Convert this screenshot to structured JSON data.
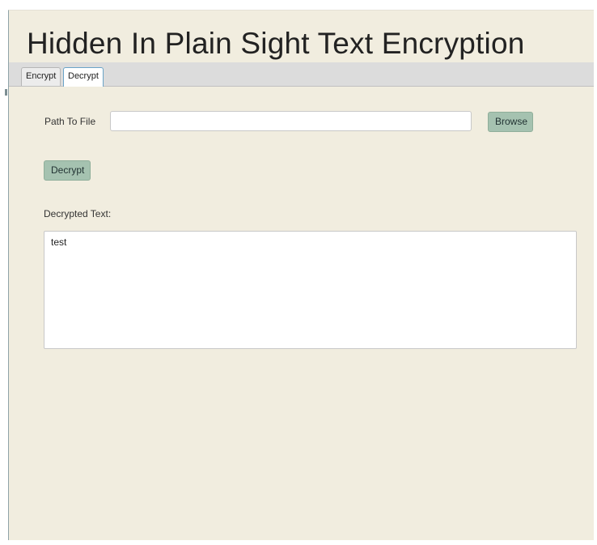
{
  "app": {
    "title": "Hidden In Plain Sight Text Encryption"
  },
  "tabs": [
    {
      "label": "Encrypt",
      "selected": false
    },
    {
      "label": "Decrypt",
      "selected": true
    }
  ],
  "decrypt_panel": {
    "path_label": "Path To File",
    "path_value": "",
    "path_placeholder": "",
    "browse_label": "Browse",
    "decrypt_label": "Decrypt",
    "decrypted_text_label": "Decrypted Text:",
    "decrypted_text_value": "test"
  },
  "colors": {
    "window_background": "#f1eddf",
    "tab_bar_background": "#dcdcdc",
    "button_background": "#a5c2b0",
    "selected_tab_border": "#6aa4c8"
  }
}
